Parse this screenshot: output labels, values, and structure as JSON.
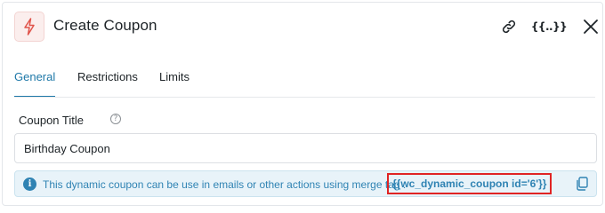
{
  "header": {
    "title": "Create Coupon",
    "merge_icon_text": "{{..}}",
    "icons": {
      "logo": "lightning-bolt-icon",
      "link": "link-icon",
      "merge": "merge-tag-icon",
      "close": "close-icon"
    }
  },
  "tabs": [
    {
      "label": "General",
      "active": true
    },
    {
      "label": "Restrictions",
      "active": false
    },
    {
      "label": "Limits",
      "active": false
    }
  ],
  "field": {
    "label": "Coupon Title",
    "help_icon": "?",
    "value": "Birthday Coupon"
  },
  "notice": {
    "info_icon": "i",
    "text": "This dynamic coupon can be use in emails or other actions using merge tag :",
    "merge_tag": "{{wc_dynamic_coupon id='6'}}"
  },
  "colors": {
    "accent": "#1e78a8",
    "notice_bg": "#e8f3f9",
    "notice_text": "#2f83b3",
    "highlight_border": "#e02424",
    "logo_red": "#e0534a"
  }
}
